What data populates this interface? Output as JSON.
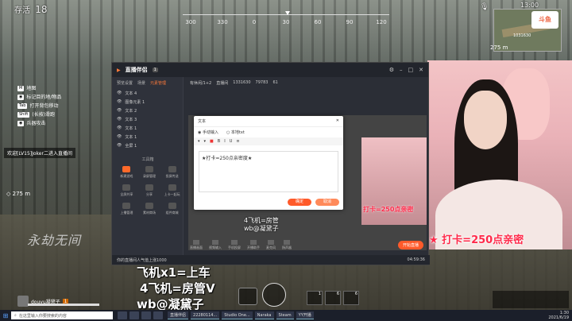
{
  "hud": {
    "alive_label": "存活",
    "alive_count": "18",
    "clock": "13:00",
    "compass_ticks": [
      "300",
      "330",
      "0",
      "30",
      "60",
      "90",
      "120"
    ],
    "distance_1": "275 m",
    "distance_2": "275 m",
    "watermark": "永劫无间",
    "minimap_label": "1031630"
  },
  "left_menu": {
    "items": [
      {
        "key": "M",
        "label": "地图"
      },
      {
        "key": "",
        "label": "标记目的地/物品"
      },
      {
        "key": "Tab",
        "label": "打开背包移动"
      },
      {
        "key": "Shift",
        "label": "(长按)滑跑"
      },
      {
        "key": "",
        "label": "兵器攻击"
      }
    ],
    "hint": "欢迎[LV15]Joker二进入直播间"
  },
  "obs": {
    "brand": "直播伴侣",
    "badge": "1",
    "tabs": [
      "预览设置",
      "场景",
      "元素管理"
    ],
    "active_tab": "元素管理",
    "layers": [
      "文本 4",
      "图像元素 1",
      "文本 2",
      "文本 3",
      "文本 1",
      "文本 1",
      "全屏 1"
    ],
    "tools_title": "工具箱",
    "tools": [
      "新建游戏",
      "录屏管理",
      "投屏传送",
      "全屏共享",
      "分享",
      "上卡一起玩",
      "上播管理",
      "素材商场",
      "组件商城"
    ],
    "top_info": [
      "有休闲/1+2",
      "直播间",
      "1331630",
      "79783",
      "61"
    ],
    "bottom_buttons": [
      "直播画面",
      "视频输入",
      "手机投屏",
      "开播助手",
      "麦克风",
      "扬声器"
    ],
    "start_live": "开始直播",
    "status_text": "你的直播间人气值上涨1000",
    "status_time": "04:59:36"
  },
  "dialog": {
    "title": "文本",
    "radio_1": "手动输入",
    "radio_2": "本地txt",
    "text_value": "★打卡=250点亲密度★",
    "ok": "确定",
    "cancel": "取消"
  },
  "stream_overlay": {
    "line_1": "飞机x1=上车",
    "line_2": "4飞机=房管V",
    "line_3": "wb@凝黛子",
    "cam_caption": "★ 打卡=250点亲密",
    "preview_caption": "打卡=250点亲密",
    "preview_line_1": "4飞机=房管",
    "preview_line_2": "wb@凝黛子"
  },
  "player": {
    "name": "douyu凝黛子",
    "level": "1"
  },
  "items_counts": [
    "1",
    "6",
    "6"
  ],
  "taskbar": {
    "search_placeholder": "在这里输入你要搜索的内容",
    "tasks": [
      "直播伴侣",
      "22280114...",
      "Studio One...",
      "Naraka",
      "Steam",
      "YY开播"
    ],
    "time": "1:30",
    "date": "2021/6/19"
  }
}
